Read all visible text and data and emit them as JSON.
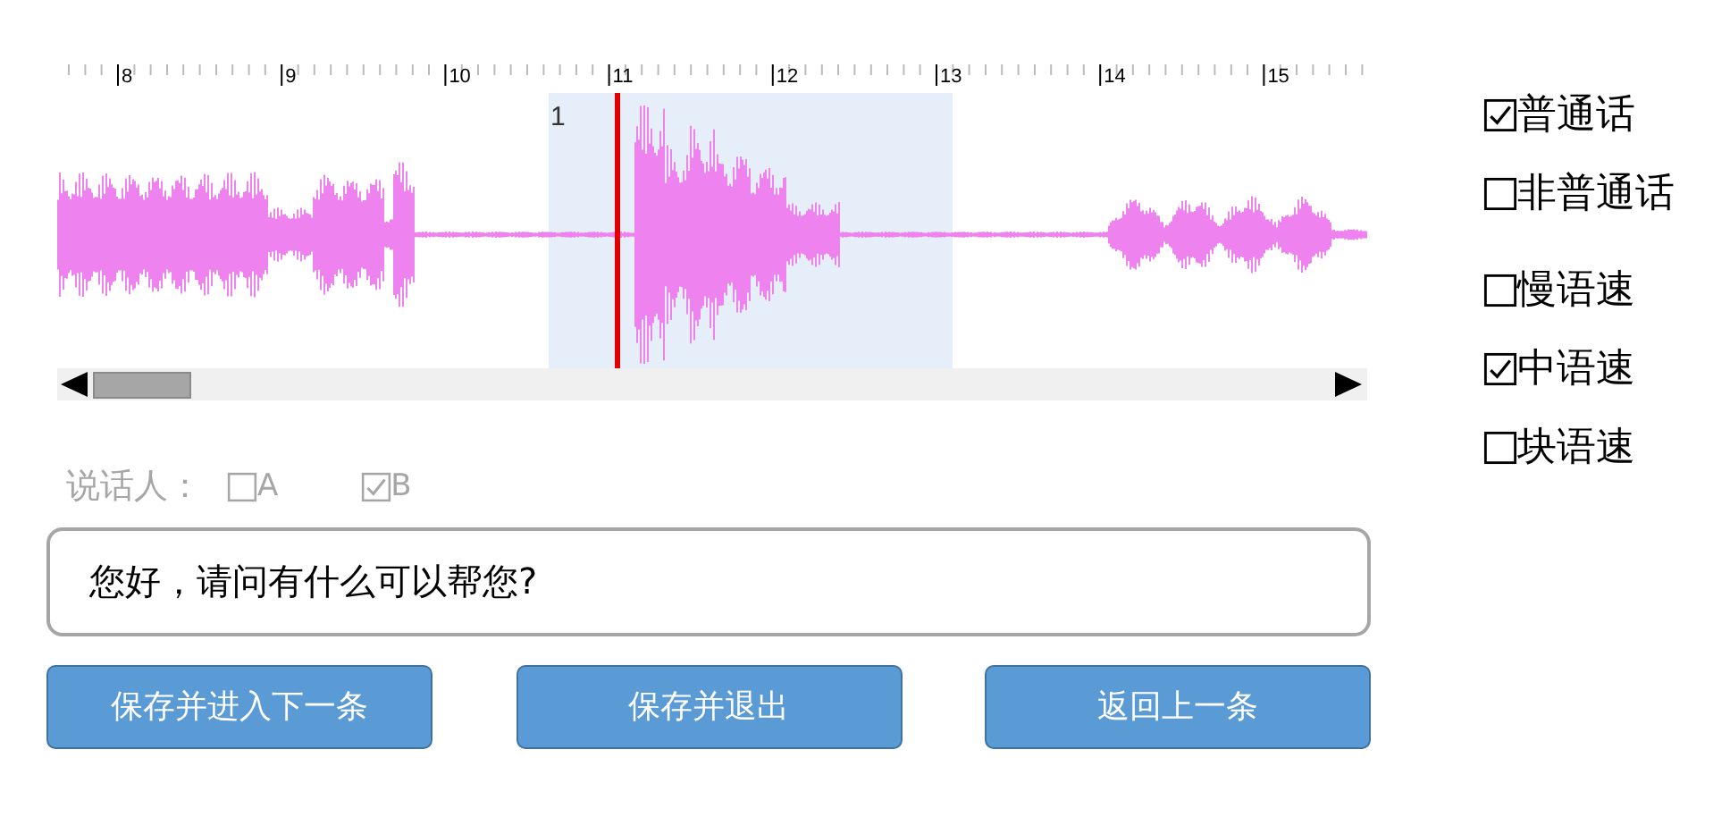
{
  "timeline": {
    "tick_labels": [
      "8",
      "9",
      "10",
      "11",
      "12",
      "13",
      "14",
      "15"
    ],
    "segment_label": "1"
  },
  "speaker": {
    "label": "说话人：",
    "options": [
      {
        "label": "A",
        "checked": false
      },
      {
        "label": "B",
        "checked": true
      }
    ]
  },
  "transcript": {
    "value": "您好，请问有什么可以帮您?"
  },
  "buttons": [
    "保存并进入下一条",
    "保存并退出",
    "返回上一条"
  ],
  "option_groups": [
    [
      {
        "label": "普通话",
        "checked": true
      },
      {
        "label": "非普通话",
        "checked": false
      }
    ],
    [
      {
        "label": "慢语速",
        "checked": false
      },
      {
        "label": "中语速",
        "checked": true
      },
      {
        "label": "块语速",
        "checked": false
      }
    ]
  ]
}
